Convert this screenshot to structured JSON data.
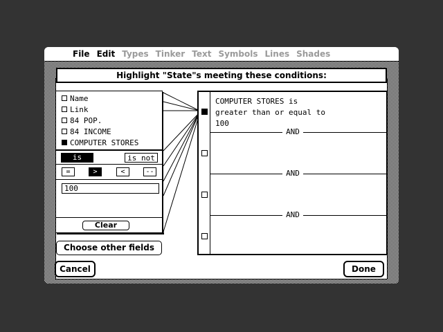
{
  "menubar": {
    "apple": "",
    "items": [
      {
        "label": "File",
        "enabled": true
      },
      {
        "label": "Edit",
        "enabled": true
      },
      {
        "label": "Types",
        "enabled": false
      },
      {
        "label": "Tinker",
        "enabled": false
      },
      {
        "label": "Text",
        "enabled": false
      },
      {
        "label": "Symbols",
        "enabled": false
      },
      {
        "label": "Lines",
        "enabled": false
      },
      {
        "label": "Shades",
        "enabled": false
      }
    ]
  },
  "dialog": {
    "title": "Highlight \"State\"s meeting these conditions:",
    "fields": [
      {
        "label": "Name",
        "checked": false
      },
      {
        "label": "Link",
        "checked": false
      },
      {
        "label": "84 POP.",
        "checked": false
      },
      {
        "label": "84 INCOME",
        "checked": false
      },
      {
        "label": "COMPUTER STORES",
        "checked": true
      }
    ],
    "is_label": "is",
    "is_not_label": "is not",
    "operators": [
      "=",
      ">",
      "<",
      "--"
    ],
    "selected_operator": ">",
    "value": "100",
    "clear_label": "Clear",
    "choose_label": "Choose other fields",
    "conditions": [
      {
        "text": "COMPUTER STORES is\ngreater than or equal to\n100",
        "checked": true
      },
      {
        "text": "",
        "checked": false
      },
      {
        "text": "",
        "checked": false
      },
      {
        "text": "",
        "checked": false
      }
    ],
    "and_label": "AND",
    "cancel_label": "Cancel",
    "done_label": "Done"
  }
}
